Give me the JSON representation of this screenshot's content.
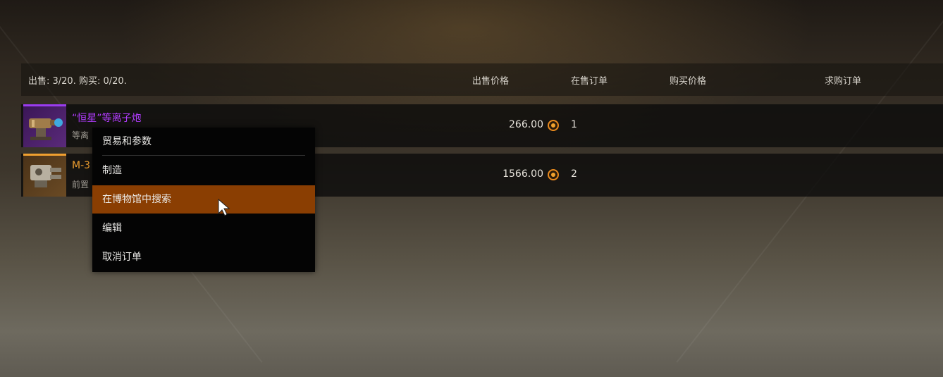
{
  "header": {
    "summary": "出售: 3/20. 购买: 0/20.",
    "col_sell_price": "出售价格",
    "col_sell_orders": "在售订单",
    "col_buy_price": "购买价格",
    "col_buy_orders": "求购订单"
  },
  "items": [
    {
      "name": "“恒星”等离子炮",
      "subtitle": "等离",
      "name_color": "#b23cff",
      "rarity_color": "#8a2be2",
      "icon": "plasma-cannon-icon",
      "sell_price": "266.00",
      "sell_orders": "1"
    },
    {
      "name": "M-3",
      "subtitle": "前置",
      "name_color": "#f0a030",
      "rarity_color": "#f0a030",
      "icon": "machine-gun-icon",
      "sell_price": "1566.00",
      "sell_orders": "2"
    }
  ],
  "context_menu": {
    "items": [
      {
        "label": "贸易和参数"
      },
      {
        "label": "制造"
      },
      {
        "label": "在博物馆中搜索",
        "highlighted": true
      },
      {
        "label": "编辑"
      },
      {
        "label": "取消订单"
      }
    ],
    "highlight_color": "#8a3e02"
  },
  "currency_icon": "coin-icon"
}
